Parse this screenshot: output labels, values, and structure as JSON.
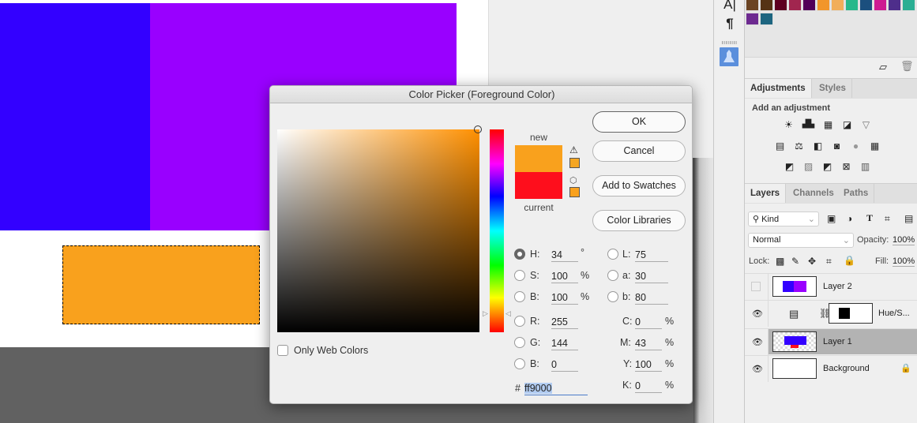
{
  "dialog": {
    "title": "Color Picker (Foreground Color)",
    "new_label": "new",
    "current_label": "current",
    "new_color": "#f9a11d",
    "current_color": "#fe0e1c",
    "buttons": {
      "ok": "OK",
      "cancel": "Cancel",
      "add_to_swatches": "Add to Swatches",
      "color_libraries": "Color Libraries"
    },
    "only_web_colors": "Only Web Colors",
    "fields": {
      "H": {
        "label": "H:",
        "value": "34",
        "unit": "°",
        "selected": true
      },
      "S": {
        "label": "S:",
        "value": "100",
        "unit": "%"
      },
      "Bv": {
        "label": "B:",
        "value": "100",
        "unit": "%"
      },
      "R": {
        "label": "R:",
        "value": "255"
      },
      "G": {
        "label": "G:",
        "value": "144"
      },
      "Bc": {
        "label": "B:",
        "value": "0"
      },
      "L": {
        "label": "L:",
        "value": "75"
      },
      "a": {
        "label": "a:",
        "value": "30"
      },
      "b": {
        "label": "b:",
        "value": "80"
      },
      "C": {
        "label": "C:",
        "value": "0",
        "unit": "%"
      },
      "M": {
        "label": "M:",
        "value": "43",
        "unit": "%"
      },
      "Y": {
        "label": "Y:",
        "value": "100",
        "unit": "%"
      },
      "K": {
        "label": "K:",
        "value": "0",
        "unit": "%"
      }
    },
    "hex_label": "#",
    "hex_value": "ff9000"
  },
  "swatches": [
    "#6b4423",
    "#553314",
    "#5e0021",
    "#a1264f",
    "#520058",
    "#f2962a",
    "#f1ae5a",
    "#27b88a",
    "#1b4f7e",
    "#cd1a91",
    "#4e2e8b",
    "#2aae93",
    "#6d2a90",
    "#1d6580"
  ],
  "adjustments": {
    "tabs": [
      "Adjustments",
      "Styles"
    ],
    "heading": "Add an adjustment"
  },
  "layers_panel": {
    "tabs": [
      "Layers",
      "Channels",
      "Paths"
    ],
    "filter": "Kind",
    "blend_mode": "Normal",
    "opacity_label": "Opacity:",
    "opacity": "100%",
    "lock_label": "Lock:",
    "fill_label": "Fill:",
    "fill": "100%",
    "layers": [
      {
        "name": "Layer 2",
        "visible": false
      },
      {
        "name": "Hue/S...",
        "visible": true
      },
      {
        "name": "Layer 1",
        "visible": true,
        "selected": true
      },
      {
        "name": "Background",
        "visible": true,
        "locked": true
      }
    ]
  },
  "tools": {
    "type": "A|",
    "paragraph": "¶"
  }
}
